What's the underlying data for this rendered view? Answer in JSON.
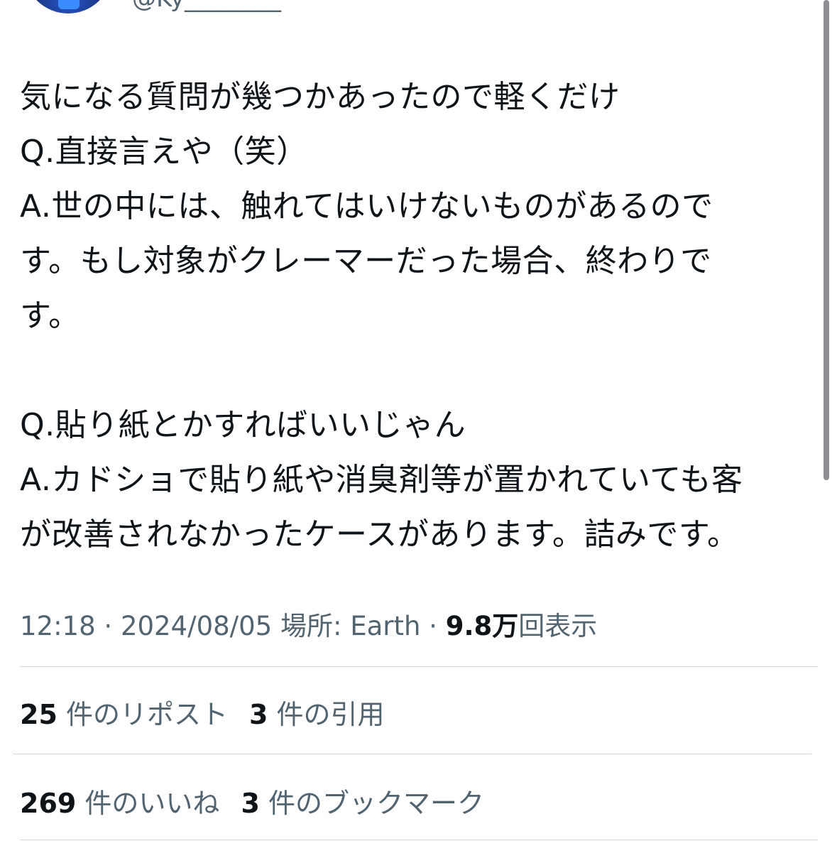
{
  "author": {
    "handle": "@Ky________"
  },
  "tweet": {
    "lines": [
      "気になる質問が幾つかあったので軽くだけ",
      "Q.直接言えや（笑）",
      "A.世の中には、触れてはいけないものがあるので",
      "す。もし対象がクレーマーだった場合、終わりで",
      "す。",
      "",
      "Q.貼り紙とかすればいいじゃん",
      "A.カドショで貼り紙や消臭剤等が置かれていても客",
      "が改善されなかったケースがあります。詰みです。"
    ]
  },
  "meta": {
    "time": "12:18",
    "sep1": " · ",
    "date": "2024/08/05",
    "location": " 場所: Earth",
    "sep2": " · ",
    "views_count": "9.8万",
    "views_label": "回表示"
  },
  "stats": {
    "reposts_count": "25",
    "reposts_label": "件のリポスト",
    "quotes_count": "3",
    "quotes_label": "件の引用",
    "likes_count": "269",
    "likes_label": "件のいいね",
    "bookmarks_count": "3",
    "bookmarks_label": "件のブックマーク"
  },
  "colors": {
    "text": "#0f1419",
    "secondary": "#536471",
    "divider": "#cfd9de"
  }
}
